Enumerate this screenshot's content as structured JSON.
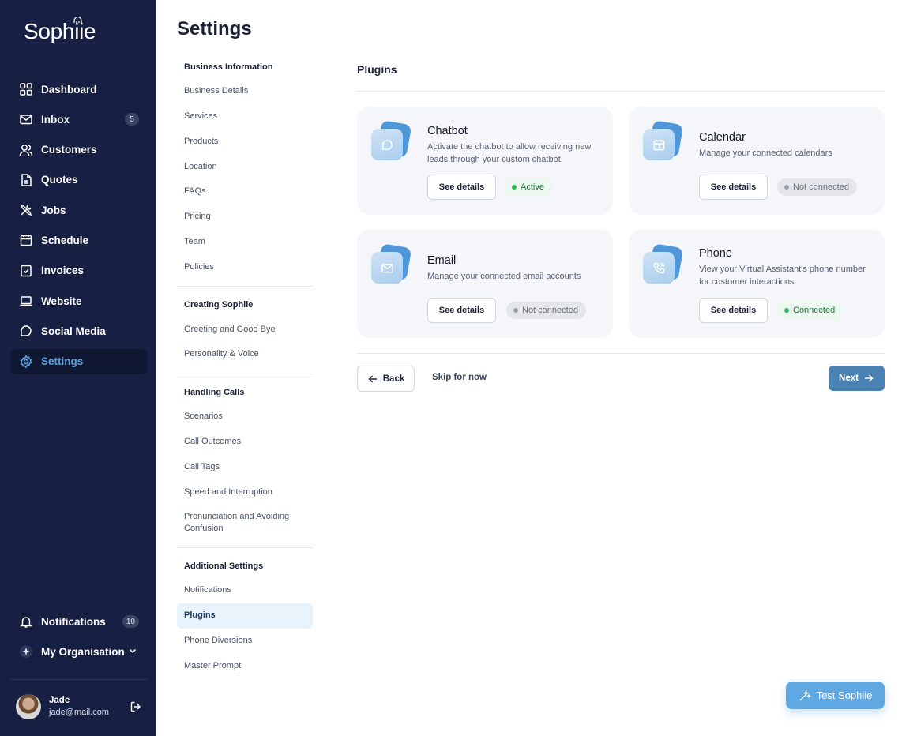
{
  "app": {
    "logo": "Sophiie"
  },
  "sidebar": {
    "items": [
      {
        "label": "Dashboard",
        "icon": "grid-icon"
      },
      {
        "label": "Inbox",
        "icon": "mail-icon",
        "badge": "5"
      },
      {
        "label": "Customers",
        "icon": "users-icon"
      },
      {
        "label": "Quotes",
        "icon": "document-icon"
      },
      {
        "label": "Jobs",
        "icon": "tools-icon"
      },
      {
        "label": "Schedule",
        "icon": "calendar-icon"
      },
      {
        "label": "Invoices",
        "icon": "invoice-icon"
      },
      {
        "label": "Website",
        "icon": "laptop-icon"
      },
      {
        "label": "Social Media",
        "icon": "chat-icon"
      },
      {
        "label": "Settings",
        "icon": "gear-icon",
        "active": true
      }
    ],
    "notifications": {
      "label": "Notifications",
      "badge": "10"
    },
    "organisation": {
      "label": "My Organisation"
    },
    "user": {
      "name": "Jade",
      "email": "jade@mail.com"
    }
  },
  "page": {
    "title": "Settings"
  },
  "submenu": [
    {
      "heading": "Business Information",
      "items": [
        "Business Details",
        "Services",
        "Products",
        "Location",
        "FAQs",
        "Pricing",
        "Team",
        "Policies"
      ]
    },
    {
      "heading": "Creating Sophiie",
      "items": [
        "Greeting and Good Bye",
        "Personality & Voice"
      ]
    },
    {
      "heading": "Handling Calls",
      "items": [
        "Scenarios",
        "Call Outcomes",
        "Call Tags",
        "Speed and Interruption",
        "Pronunciation and Avoiding Confusion"
      ]
    },
    {
      "heading": "Additional Settings",
      "items": [
        "Notifications",
        "Plugins",
        "Phone Diversions",
        "Master Prompt"
      ]
    }
  ],
  "main": {
    "title": "Plugins",
    "plugins": {
      "chatbot": {
        "title": "Chatbot",
        "desc": "Activate the chatbot to allow receiving new leads through your custom chatbot",
        "button": "See details",
        "status": "Active"
      },
      "calendar": {
        "title": "Calendar",
        "desc": "Manage your connected calendars",
        "button": "See details",
        "status": "Not connected"
      },
      "email": {
        "title": "Email",
        "desc": "Manage your connected email accounts",
        "button": "See details",
        "status": "Not connected"
      },
      "phone": {
        "title": "Phone",
        "desc": "View your Virtual Assistant's phone number for customer interactions",
        "button": "See details",
        "status": "Connected"
      }
    },
    "back": "Back",
    "skip": "Skip for now",
    "next": "Next",
    "test": "Test Sophiie"
  },
  "colors": {
    "sidebar_bg": "#172043",
    "accent": "#5aa2e0",
    "primary_button": "#4a82b4",
    "test_button": "#5fa8e2",
    "status_green": "#2fb55b"
  }
}
